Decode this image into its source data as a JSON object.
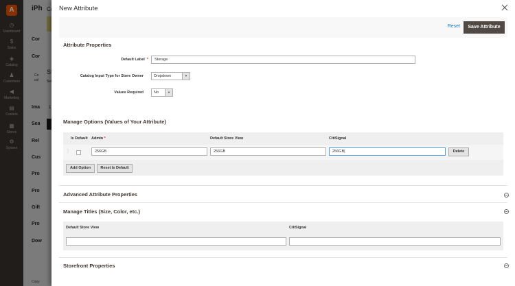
{
  "background": {
    "title": "iPh",
    "title_suffix": "Co",
    "left_labels": [
      "Cor",
      "Cor",
      "Ima",
      "Sea",
      "Rel",
      "Cus",
      "Pro",
      "Pro",
      "Gift",
      "Pro",
      "Dow"
    ],
    "inner_labels": [
      "St",
      "Sel",
      "Co",
      "col"
    ],
    "small_number": "1",
    "copyright": "Copy"
  },
  "sidebar": {
    "logo": "A",
    "items": [
      {
        "label": "Dashboard",
        "icon": "dashboard-icon",
        "glyph": "◷"
      },
      {
        "label": "Sales",
        "icon": "sales-icon",
        "glyph": "$"
      },
      {
        "label": "Catalog",
        "icon": "catalog-icon",
        "glyph": "◈"
      },
      {
        "label": "Customers",
        "icon": "customers-icon",
        "glyph": "♟"
      },
      {
        "label": "Marketing",
        "icon": "marketing-icon",
        "glyph": "◀"
      },
      {
        "label": "Content",
        "icon": "content-icon",
        "glyph": "▤"
      },
      {
        "label": "Stores",
        "icon": "stores-icon",
        "glyph": "▦"
      },
      {
        "label": "System",
        "icon": "system-icon",
        "glyph": "⚙"
      }
    ]
  },
  "modal": {
    "title": "New Attribute",
    "actions": {
      "reset": "Reset",
      "save": "Save Attribute"
    },
    "properties": {
      "section_title": "Attribute Properties",
      "default_label": {
        "label": "Default Label",
        "value": "Storage"
      },
      "input_type": {
        "label": "Catalog Input Type for Store Owner",
        "value": "Dropdown"
      },
      "values_required": {
        "label": "Values Required",
        "value": "No"
      }
    },
    "options": {
      "section_title": "Manage Options (Values of Your Attribute)",
      "headers": {
        "is_default": "Is Default",
        "admin": "Admin",
        "default_store_view": "Default Store View",
        "citisignal": "CitiSignal"
      },
      "row": {
        "admin": "256GB",
        "default_store_view": "256GB",
        "citisignal": "256GB",
        "delete": "Delete"
      },
      "add_option": "Add Option",
      "reset_default": "Reset Is Default"
    },
    "advanced": {
      "section_title": "Advanced Attribute Properties"
    },
    "titles": {
      "section_title": "Manage Titles (Size, Color, etc.)",
      "headers": {
        "default_store_view": "Default Store View",
        "citisignal": "CitiSignal"
      },
      "values": {
        "default_store_view": "",
        "citisignal": ""
      }
    },
    "storefront": {
      "section_title": "Storefront Properties"
    }
  },
  "colors": {
    "primary_button": "#514943",
    "link": "#1979c3",
    "sidebar": "#373330",
    "brand": "#eb5202",
    "required": "#e22626"
  }
}
